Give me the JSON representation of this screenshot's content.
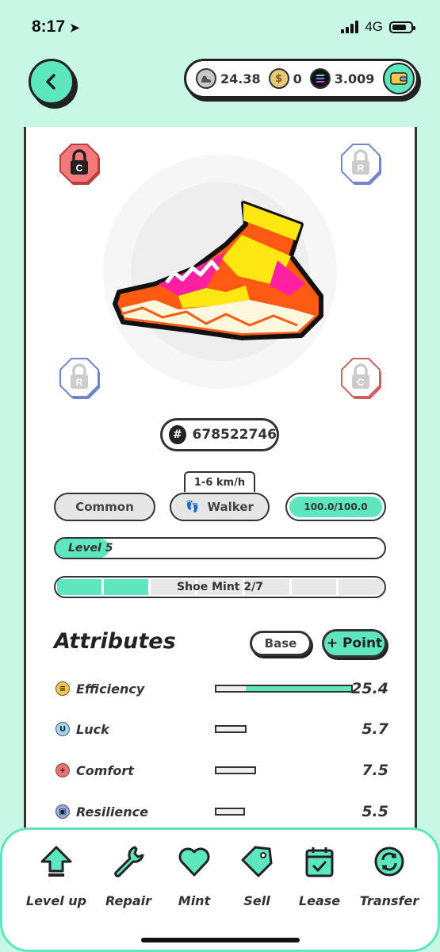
{
  "status_bar": {
    "time": "8:17",
    "network": "4G"
  },
  "currencies": [
    {
      "icon": "sneaker-coin-icon",
      "value": "24.38"
    },
    {
      "icon": "gmt-coin-icon",
      "value": "0"
    },
    {
      "icon": "sol-coin-icon",
      "value": "3.009"
    }
  ],
  "locks": {
    "top_left": "C",
    "top_right": "R",
    "bottom_left": "R",
    "bottom_right": "C"
  },
  "sneaker": {
    "id_symbol": "#",
    "id": "678522746",
    "speed": "1-6 km/h",
    "quality": "Common",
    "type": "Walker",
    "durability": "100.0/100.0",
    "level": "Level 5",
    "mint": "Shoe Mint 2/7",
    "mint_count": 2,
    "mint_total": 7,
    "colors": {
      "orange": "#ff5a14",
      "yellow": "#ffe812",
      "magenta": "#ff1fa3",
      "cream": "#fff8dc"
    }
  },
  "attributes": {
    "title": "Attributes",
    "base_label": "Base",
    "point_label": "+ Point",
    "items": [
      {
        "name": "Efficiency",
        "value": "25.4",
        "fill": 0.78,
        "icon": "efficiency-icon",
        "color": "#f5c842"
      },
      {
        "name": "Luck",
        "value": "5.7",
        "fill": 0.0,
        "icon": "luck-icon",
        "color": "#9fd8f5"
      },
      {
        "name": "Comfort",
        "value": "7.5",
        "fill": 0.0,
        "icon": "comfort-icon",
        "color": "#f07070"
      },
      {
        "name": "Resilience",
        "value": "5.5",
        "fill": 0.0,
        "icon": "resilience-icon",
        "color": "#8fa8e8"
      }
    ]
  },
  "nav": [
    {
      "label": "Level up",
      "icon": "level-up-icon"
    },
    {
      "label": "Repair",
      "icon": "wrench-icon"
    },
    {
      "label": "Mint",
      "icon": "heart-icon"
    },
    {
      "label": "Sell",
      "icon": "tag-icon"
    },
    {
      "label": "Lease",
      "icon": "calendar-icon"
    },
    {
      "label": "Transfer",
      "icon": "transfer-icon"
    }
  ],
  "accent_color": "#5ee6be"
}
